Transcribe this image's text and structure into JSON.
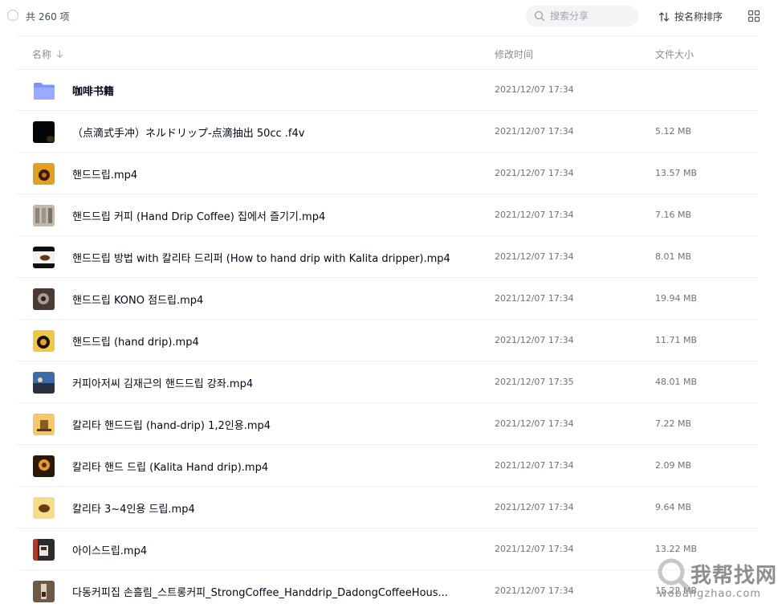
{
  "toolbar": {
    "count_label": "共 260 项",
    "search_placeholder": "搜索分享",
    "sort_label": "按名称排序"
  },
  "columns": {
    "name": "名称",
    "modified": "修改时间",
    "size": "文件大小"
  },
  "rows": [
    {
      "name": "咖啡书籍",
      "modified": "2021/12/07 17:34",
      "size": "",
      "type": "folder"
    },
    {
      "name": "（点滴式手冲）ネルドリップ-点滴抽出 50cc .f4v",
      "modified": "2021/12/07 17:34",
      "size": "5.12 MB",
      "type": "video"
    },
    {
      "name": "핸드드립.mp4",
      "modified": "2021/12/07 17:34",
      "size": "13.57 MB",
      "type": "video"
    },
    {
      "name": "핸드드립 커피 (Hand Drip Coffee) 집에서 즐기기.mp4",
      "modified": "2021/12/07 17:34",
      "size": "7.16 MB",
      "type": "video"
    },
    {
      "name": "핸드드립 방법 with 칼리타 드리퍼 (How to hand drip with Kalita dripper).mp4",
      "modified": "2021/12/07 17:34",
      "size": "8.01 MB",
      "type": "video"
    },
    {
      "name": "핸드드립 KONO 점드립.mp4",
      "modified": "2021/12/07 17:34",
      "size": "19.94 MB",
      "type": "video"
    },
    {
      "name": "핸드드립 (hand drip).mp4",
      "modified": "2021/12/07 17:34",
      "size": "11.71 MB",
      "type": "video"
    },
    {
      "name": "커피아저씨 김재근의 핸드드립 강좌.mp4",
      "modified": "2021/12/07 17:35",
      "size": "48.01 MB",
      "type": "video"
    },
    {
      "name": "칼리타 핸드드립 (hand-drip) 1,2인용.mp4",
      "modified": "2021/12/07 17:34",
      "size": "7.22 MB",
      "type": "video"
    },
    {
      "name": "칼리타 핸드 드립 (Kalita Hand drip).mp4",
      "modified": "2021/12/07 17:34",
      "size": "2.09 MB",
      "type": "video"
    },
    {
      "name": "칼리타 3~4인용 드립.mp4",
      "modified": "2021/12/07 17:34",
      "size": "9.64 MB",
      "type": "video"
    },
    {
      "name": "아이스드립.mp4",
      "modified": "2021/12/07 17:34",
      "size": "13.22 MB",
      "type": "video"
    },
    {
      "name": "다동커피집 손흘림_스트롱커피_StrongCoffee_Handdrip_DadongCoffeeHous...",
      "modified": "2021/12/07 17:34",
      "size": "15.22 MB",
      "type": "video"
    }
  ],
  "watermark": {
    "text": "我帮找网",
    "sub": "wobangzhao.com"
  },
  "colors": {
    "folder": "#8fa0ff",
    "text_primary": "#03081a",
    "text_secondary": "#6d727a",
    "divider": "#eef0f2"
  }
}
